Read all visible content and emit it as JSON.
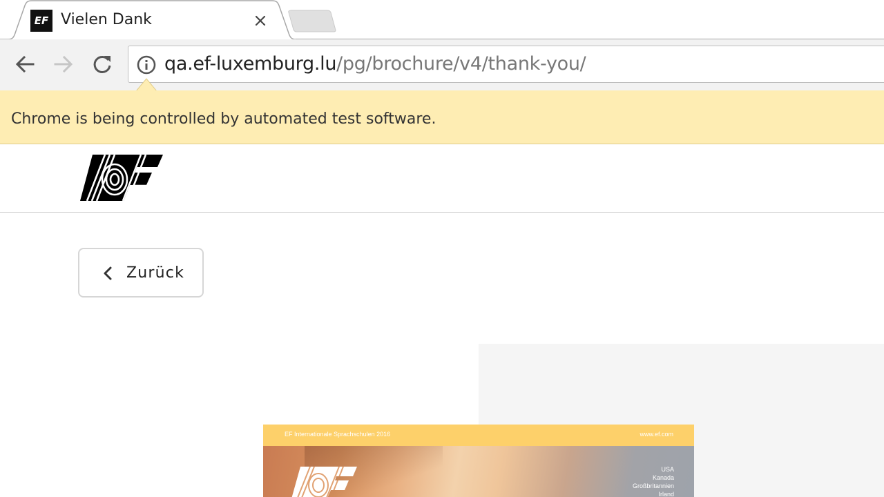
{
  "browser": {
    "tab": {
      "title": "Vielen Dank",
      "favicon": "ef-logo-icon",
      "close_icon": "close-icon"
    },
    "new_tab_icon": "new-tab-icon",
    "toolbar": {
      "back_icon": "arrow-left-icon",
      "forward_icon": "arrow-right-icon",
      "reload_icon": "reload-icon",
      "info_icon": "info-icon"
    },
    "url": {
      "host": "qa.ef-luxemburg.lu",
      "path": "/pg/brochure/v4/thank-you/"
    },
    "infobar": {
      "text": "Chrome is being controlled by automated test software."
    }
  },
  "page": {
    "logo": "ef-logo-icon",
    "back_button": {
      "label": "Zurück",
      "icon": "chevron-left-icon"
    },
    "brochure": {
      "header_left": "EF Internationale Sprachschulen 2016",
      "header_right": "www.ef.com",
      "countries": [
        "USA",
        "Kanada",
        "Großbritannien",
        "Irland"
      ]
    }
  },
  "colors": {
    "infobar_bg": "#feedb3",
    "toolbar_bg": "#f2f2f2",
    "brochure_bar": "#fdd06a",
    "panel_bg": "#f5f5f5"
  }
}
